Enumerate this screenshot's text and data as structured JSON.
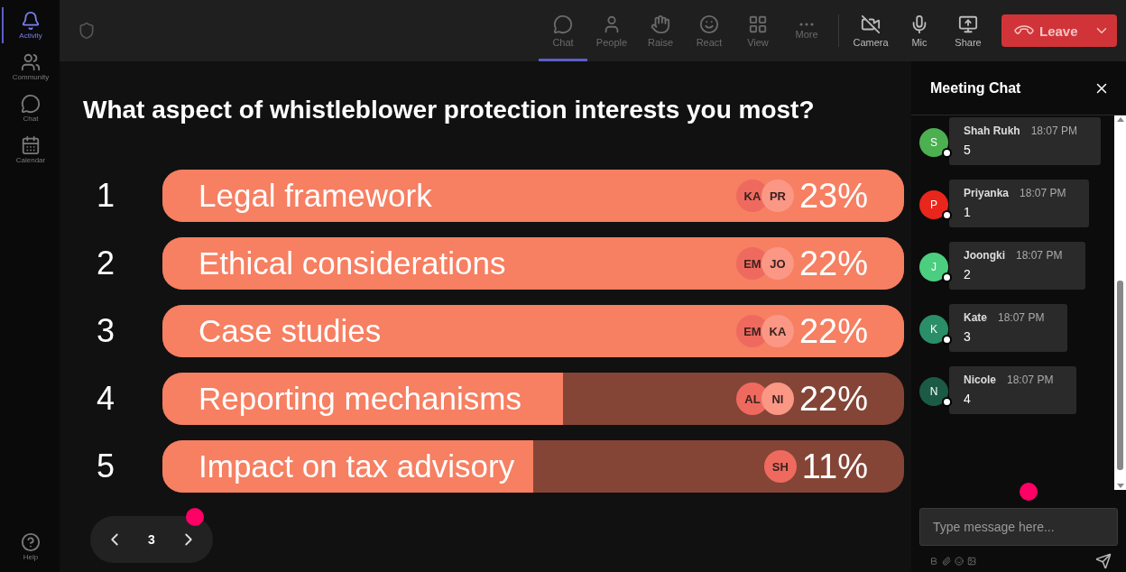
{
  "sidebar": {
    "items": [
      {
        "label": "Activity",
        "selected": true
      },
      {
        "label": "Community",
        "selected": false
      },
      {
        "label": "Chat",
        "selected": false
      },
      {
        "label": "Calendar",
        "selected": false
      }
    ],
    "help": "Help"
  },
  "toolbar": {
    "items": [
      {
        "label": "Chat",
        "selected": true
      },
      {
        "label": "People",
        "selected": false
      },
      {
        "label": "Raise",
        "selected": false
      },
      {
        "label": "React",
        "selected": false
      },
      {
        "label": "View",
        "selected": false
      },
      {
        "label": "More",
        "selected": false
      }
    ],
    "devices": [
      {
        "label": "Camera"
      },
      {
        "label": "Mic"
      },
      {
        "label": "Share"
      }
    ],
    "leave": "Leave"
  },
  "poll": {
    "question": "What aspect of whistleblower protection interests you most?",
    "options": [
      {
        "number": "1",
        "label": "Legal framework",
        "level": 1,
        "voters": [
          "KA",
          "PR"
        ],
        "percent": "23%"
      },
      {
        "number": "2",
        "label": "Ethical considerations",
        "level": 1,
        "voters": [
          "EM",
          "JO"
        ],
        "percent": "22%"
      },
      {
        "number": "3",
        "label": "Case studies",
        "level": 1,
        "voters": [
          "EM",
          "KA"
        ],
        "percent": "22%"
      },
      {
        "number": "4",
        "label": "Reporting mechanisms",
        "level": 0.54,
        "voters": [
          "AL",
          "NI"
        ],
        "percent": "22%"
      },
      {
        "number": "5",
        "label": "Impact on tax advisory",
        "level": 0.5,
        "voters": [
          "SH"
        ],
        "percent": "11%"
      }
    ],
    "page": "3"
  },
  "chat": {
    "title": "Meeting Chat",
    "messages": [
      {
        "initial": "S",
        "name": "Shah Rukh",
        "time": "18:07 PM",
        "text": "5",
        "color": "#4caf50"
      },
      {
        "initial": "P",
        "name": "Priyanka",
        "time": "18:07 PM",
        "text": "1",
        "color": "#e8261c"
      },
      {
        "initial": "J",
        "name": "Joongki",
        "time": "18:07 PM",
        "text": "2",
        "color": "#4cce80"
      },
      {
        "initial": "K",
        "name": "Kate",
        "time": "18:07 PM",
        "text": "3",
        "color": "#2a8f68"
      },
      {
        "initial": "N",
        "name": "Nicole",
        "time": "18:07 PM",
        "text": "4",
        "color": "#1b5a44"
      }
    ],
    "placeholder": "Type message here..."
  }
}
